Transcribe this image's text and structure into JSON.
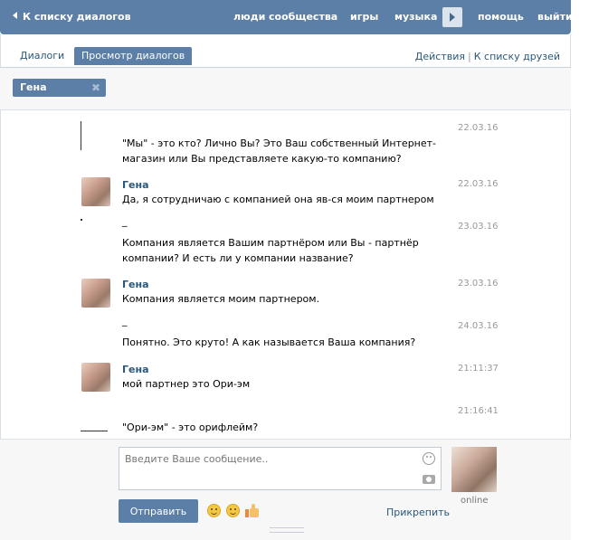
{
  "topbar": {
    "back_label": "К списку диалогов",
    "nav": [
      "люди",
      "сообщества",
      "игры",
      "музыка",
      "помощь",
      "выйти"
    ]
  },
  "tabs": {
    "dialogs": "Диалоги",
    "view": "Просмотр диалогов",
    "actions": "Действия",
    "separator": "|",
    "friends": "К списку друзей"
  },
  "filter": {
    "chip_label": "Гена",
    "chip_close": "✖"
  },
  "messages": [
    {
      "date": "22.03.16",
      "sender": "",
      "text": "\"Мы\" - это кто? Лично Вы? Это Ваш собственный Интернет-магазин или Вы представляете какую-то компанию?"
    },
    {
      "date": "22.03.16",
      "sender": "Гена",
      "text": "Да, я сотрудничаю с компанией она яв-ся моим партнером"
    },
    {
      "date": "23.03.16",
      "sender": "",
      "dash": "_",
      "text": "Компания является Вашим партнёром или Вы - партнёр компании? И есть ли у компании название?"
    },
    {
      "date": "23.03.16",
      "sender": "Гена",
      "text": "Компания является моим партнером."
    },
    {
      "date": "24.03.16",
      "sender": "",
      "dash": "_",
      "text": "Понятно. Это круто! А как называется Ваша компания?"
    },
    {
      "date": "21:11:37",
      "sender": "Гена",
      "text": "мой партнер это Ори-эм"
    },
    {
      "date": "21:16:41",
      "sender": "",
      "text": "\"Ори-эм\" - это орифлейм?"
    }
  ],
  "compose": {
    "placeholder": "Введите Ваше сообщение..",
    "send_label": "Отправить",
    "attach_label": "Прикрепить",
    "status": "online"
  }
}
